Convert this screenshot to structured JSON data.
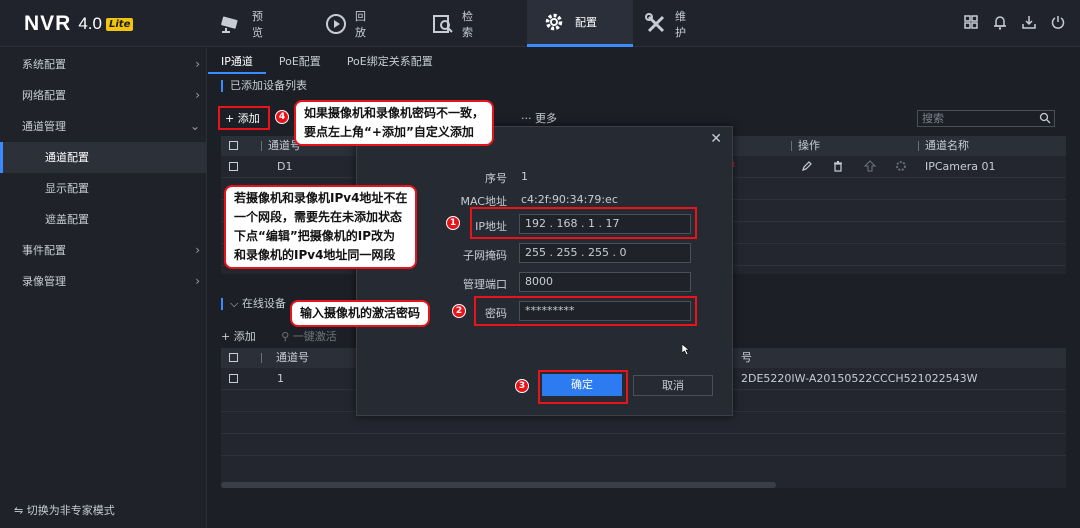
{
  "header": {
    "logo_nvr": "NVR",
    "logo_version": "4.0",
    "logo_badge": "Lite",
    "nav": [
      {
        "label": "预览",
        "icon": "camera-icon"
      },
      {
        "label": "回放",
        "icon": "playback-icon"
      },
      {
        "label": "检索",
        "icon": "search-doc-icon"
      },
      {
        "label": "配置",
        "icon": "gear-icon",
        "active": true
      },
      {
        "label": "维护",
        "icon": "wrench-icon"
      }
    ],
    "right_icons": [
      "grid-icon",
      "bell-icon",
      "download-icon",
      "power-icon"
    ]
  },
  "sidebar": {
    "items": [
      {
        "label": "系统配置",
        "expandable": true
      },
      {
        "label": "网络配置",
        "expandable": true
      },
      {
        "label": "通道管理",
        "expandable": true
      },
      {
        "label": "通道配置",
        "sub": true,
        "active": true
      },
      {
        "label": "显示配置",
        "sub": true
      },
      {
        "label": "遮盖配置",
        "sub": true
      },
      {
        "label": "事件配置",
        "expandable": true
      },
      {
        "label": "录像管理",
        "expandable": true
      }
    ],
    "footer": "切换为非专家模式"
  },
  "main": {
    "tabs": [
      {
        "label": "IP通道",
        "active": true
      },
      {
        "label": "PoE配置"
      },
      {
        "label": "PoE绑定关系配置"
      }
    ],
    "section_title": "已添加设备列表",
    "add_label": "+ 添加",
    "more_label": "··· 更多",
    "search_placeholder": "搜索",
    "table1": {
      "headers": [
        "通道号",
        "操作",
        "通道名称"
      ],
      "rows": [
        {
          "channel": "D1",
          "name": "IPCamera 01"
        }
      ]
    },
    "section2_title": "在线设备",
    "section2_add": "+ 添加",
    "section2_activate": "一键激活",
    "table2": {
      "headers": [
        "通道号",
        "号"
      ],
      "rows": [
        {
          "channel": "1",
          "serial": "2DE5220IW-A20150522CCCH521022543W"
        }
      ]
    }
  },
  "dialog": {
    "fields": [
      {
        "label": "序号",
        "value": "1"
      },
      {
        "label": "MAC地址",
        "value": "c4:2f:90:34:79:ec"
      },
      {
        "label": "IP地址",
        "value": "192 . 168 . 1   . 17"
      },
      {
        "label": "子网掩码",
        "value": "255 . 255 . 255 . 0"
      },
      {
        "label": "管理端口",
        "value": "8000"
      },
      {
        "label": "密码",
        "value": "*********"
      }
    ],
    "ok_label": "确定",
    "cancel_label": "取消"
  },
  "annotations": {
    "badges": [
      "1",
      "2",
      "3",
      "4"
    ],
    "callout4": [
      "如果摄像机和录像机密码不一致，",
      "要点左上角“+添加”自定义添加"
    ],
    "callout1": [
      "若摄像机和录像机IPv4地址不在",
      "一个网段，需要先在未添加状态",
      "下点“编辑”把摄像机的IP改为",
      "和录像机的IPv4地址同一网段"
    ],
    "callout2": [
      "输入摄像机的激活密码"
    ],
    "highlight_color": "#e8141a"
  },
  "colors": {
    "accent": "#3a8bff",
    "ok_button": "#2d7bf0",
    "status_red": "#e8141a"
  }
}
